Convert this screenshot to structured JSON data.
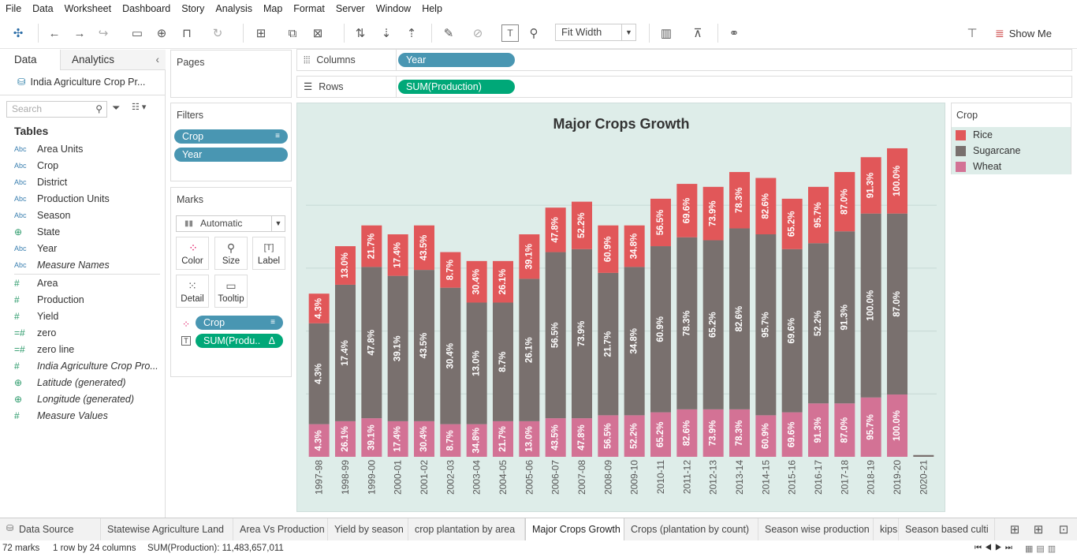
{
  "menu": [
    "File",
    "Data",
    "Worksheet",
    "Dashboard",
    "Story",
    "Analysis",
    "Map",
    "Format",
    "Server",
    "Window",
    "Help"
  ],
  "toolbar": {
    "fit_label": "Fit Width",
    "show_me": "Show Me"
  },
  "left": {
    "tab_data": "Data",
    "tab_analytics": "Analytics",
    "datasource": "India Agriculture Crop Pr...",
    "search_placeholder": "Search",
    "tables_header": "Tables",
    "dimensions": [
      {
        "type": "Abc",
        "name": "Area Units"
      },
      {
        "type": "Abc",
        "name": "Crop"
      },
      {
        "type": "Abc",
        "name": "District"
      },
      {
        "type": "Abc",
        "name": "Production Units"
      },
      {
        "type": "Abc",
        "name": "Season"
      },
      {
        "type": "geo",
        "name": "State"
      },
      {
        "type": "Abc",
        "name": "Year"
      },
      {
        "type": "Abc",
        "name": "Measure Names",
        "italic": true
      }
    ],
    "measures": [
      {
        "type": "#",
        "name": "Area"
      },
      {
        "type": "#",
        "name": "Production"
      },
      {
        "type": "#",
        "name": "Yield"
      },
      {
        "type": "=#",
        "name": "zero"
      },
      {
        "type": "=#",
        "name": "zero line"
      },
      {
        "type": "#",
        "name": "India Agriculture Crop Pro...",
        "italic": true
      },
      {
        "type": "geo",
        "name": "Latitude (generated)",
        "italic": true
      },
      {
        "type": "geo",
        "name": "Longitude (generated)",
        "italic": true
      },
      {
        "type": "#",
        "name": "Measure Values",
        "italic": true
      }
    ]
  },
  "cards": {
    "pages": "Pages",
    "filters": "Filters",
    "filter_pills": [
      "Crop",
      "Year"
    ],
    "marks": "Marks",
    "mark_type": "Automatic",
    "mark_buttons": [
      "Color",
      "Size",
      "Label",
      "Detail",
      "Tooltip"
    ],
    "mark_pills": [
      "Crop",
      "SUM(Produ.."
    ]
  },
  "shelves": {
    "columns_label": "Columns",
    "columns_pill": "Year",
    "rows_label": "Rows",
    "rows_pill": "SUM(Production)"
  },
  "legend": {
    "title": "Crop",
    "items": [
      {
        "name": "Rice",
        "color": "#e15759"
      },
      {
        "name": "Sugarcane",
        "color": "#79706e"
      },
      {
        "name": "Wheat",
        "color": "#d37295"
      }
    ]
  },
  "chart_data": {
    "type": "bar",
    "stacked": true,
    "title": "Major Crops Growth",
    "categories": [
      "1997-98",
      "1998-99",
      "1999-00",
      "2000-01",
      "2001-02",
      "2002-03",
      "2003-04",
      "2004-05",
      "2005-06",
      "2006-07",
      "2007-08",
      "2008-09",
      "2009-10",
      "2010-11",
      "2011-12",
      "2012-13",
      "2013-14",
      "2014-15",
      "2015-16",
      "2016-17",
      "2017-18",
      "2018-19",
      "2019-20",
      "2020-21"
    ],
    "ylim": [
      0,
      100
    ],
    "grid": true,
    "series": [
      {
        "name": "Wheat",
        "color": "#d37295",
        "values": [
          11,
          12,
          13,
          12,
          12,
          11,
          11,
          12,
          12,
          13,
          13,
          14,
          14,
          15,
          16,
          16,
          16,
          14,
          15,
          18,
          18,
          20,
          21,
          0
        ],
        "labels": [
          "4.3%",
          "26.1%",
          "39.1%",
          "17.4%",
          "30.4%",
          "8.7%",
          "34.8%",
          "21.7%",
          "13.0%",
          "43.5%",
          "47.8%",
          "56.5%",
          "52.2%",
          "65.2%",
          "82.6%",
          "73.9%",
          "78.3%",
          "60.9%",
          "69.6%",
          "91.3%",
          "87.0%",
          "95.7%",
          "100.0%",
          ""
        ]
      },
      {
        "name": "Sugarcane",
        "color": "#79706e",
        "values": [
          34,
          46,
          51,
          49,
          51,
          46,
          41,
          40,
          48,
          56,
          57,
          48,
          50,
          56,
          58,
          57,
          61,
          61,
          55,
          54,
          58,
          62,
          61,
          1.5
        ],
        "labels": [
          "4.3%",
          "17.4%",
          "47.8%",
          "39.1%",
          "43.5%",
          "30.4%",
          "13.0%",
          "8.7%",
          "26.1%",
          "56.5%",
          "73.9%",
          "21.7%",
          "34.8%",
          "60.9%",
          "78.3%",
          "65.2%",
          "82.6%",
          "95.7%",
          "69.6%",
          "52.2%",
          "91.3%",
          "100.0%",
          "87.0%",
          ""
        ]
      },
      {
        "name": "Rice",
        "color": "#e15759",
        "values": [
          10,
          13,
          14,
          14,
          15,
          12,
          14,
          14,
          15,
          15,
          16,
          16,
          14,
          16,
          18,
          18,
          19,
          19,
          17,
          19,
          20,
          19,
          22,
          0
        ],
        "labels": [
          "4.3%",
          "13.0%",
          "21.7%",
          "17.4%",
          "43.5%",
          "8.7%",
          "30.4%",
          "26.1%",
          "39.1%",
          "47.8%",
          "52.2%",
          "60.9%",
          "34.8%",
          "56.5%",
          "69.6%",
          "73.9%",
          "78.3%",
          "82.6%",
          "65.2%",
          "95.7%",
          "87.0%",
          "91.3%",
          "100.0%",
          ""
        ]
      }
    ]
  },
  "tabs": [
    "Data Source",
    "Statewise Agriculture Land",
    "Area Vs Production",
    "Yield by season",
    "crop plantation by area",
    "Major Crops Growth",
    "Crops (plantation by count)",
    "Season wise production",
    "kips",
    "Season based culti"
  ],
  "active_tab": "Major Crops Growth",
  "status": {
    "marks": "72 marks",
    "dims": "1 row by 24 columns",
    "sum": "SUM(Production): 11,483,657,011"
  }
}
